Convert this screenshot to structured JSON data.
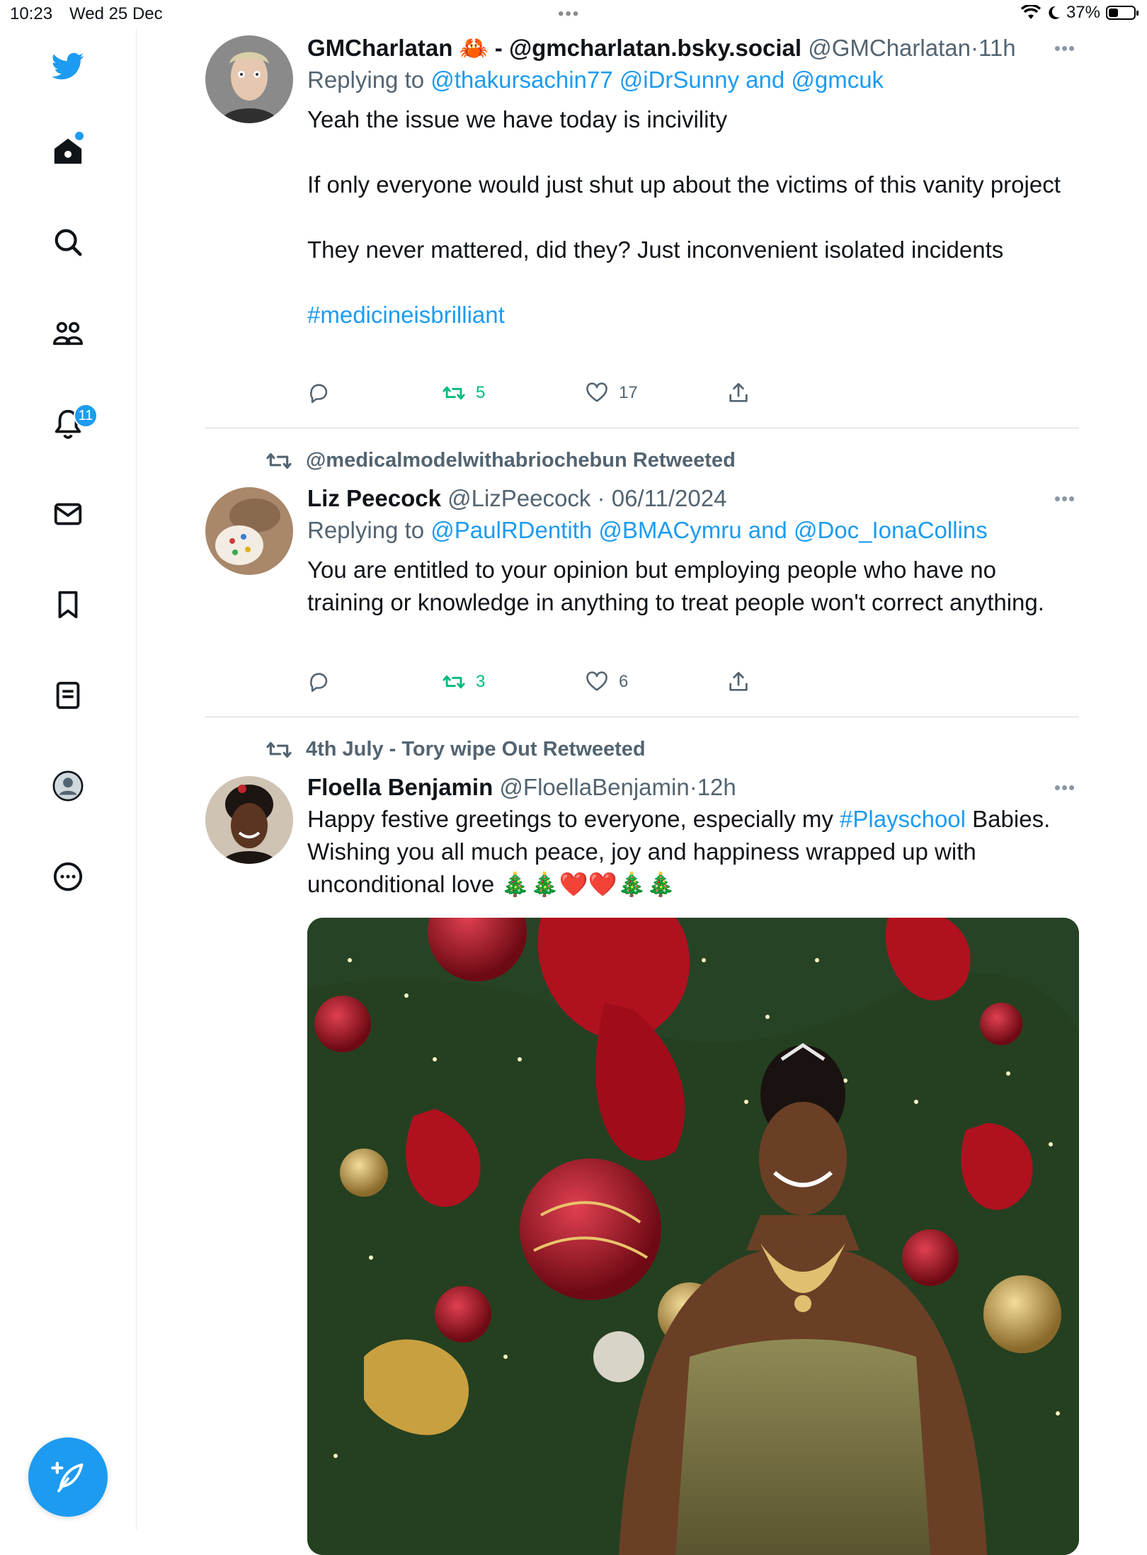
{
  "status_bar": {
    "time": "10:23",
    "date": "Wed 25 Dec",
    "battery": "37%",
    "battery_level": 0.37
  },
  "sidebar": {
    "items": [
      {
        "name": "twitter-logo",
        "icon": "bird"
      },
      {
        "name": "home",
        "icon": "home"
      },
      {
        "name": "explore",
        "icon": "search"
      },
      {
        "name": "communities",
        "icon": "people"
      },
      {
        "name": "notifications",
        "icon": "bell",
        "badge": "11"
      },
      {
        "name": "messages",
        "icon": "envelope"
      },
      {
        "name": "bookmarks",
        "icon": "bookmark"
      },
      {
        "name": "lists",
        "icon": "list"
      },
      {
        "name": "profile",
        "icon": "person"
      },
      {
        "name": "more",
        "icon": "dots-circle"
      }
    ],
    "compose_icon": "feather-plus",
    "accent": "#1d9bf0"
  },
  "tweets": [
    {
      "display_name": "GMCharlatan",
      "name_emoji": "🦀",
      "name_suffix": " - @gmcharlatan.bsky.social",
      "handle": "@GMCharlatan",
      "separator": "·",
      "time": "11h",
      "replying_prefix": "Replying to ",
      "replying_to": "@thakursachin77 @iDrSunny and @gmcuk",
      "text_paragraphs": [
        "Yeah the issue we have today is incivility",
        "If only everyone would just shut up about the victims of this vanity project",
        "They never mattered, did they? Just inconvenient isolated incidents"
      ],
      "hashtag": "#medicineisbrilliant",
      "retweets": "5",
      "likes": "17"
    },
    {
      "retweeted_by": "@medicalmodelwithabriochebun Retweeted",
      "display_name": "Liz Peecock",
      "handle": "@LizPeecock",
      "separator": "·",
      "time": "06/11/2024",
      "replying_prefix": "Replying to ",
      "replying_to": "@PaulRDentith @BMACymru and @Doc_IonaCollins",
      "text": "You are entitled to your opinion but employing people who have no training or knowledge in anything to treat people won't correct anything.",
      "retweets": "3",
      "likes": "6"
    },
    {
      "retweeted_by": "4th July - Tory wipe Out Retweeted",
      "display_name": "Floella Benjamin",
      "handle": "@FloellaBenjamin",
      "separator": "·",
      "time": "12h",
      "text_before": "Happy festive greetings to everyone, especially my ",
      "hashtag": "#Playschool",
      "text_after": " Babies. Wishing you all much peace, joy and happiness wrapped up with unconditional love 🎄🎄❤️❤️🎄🎄"
    }
  ]
}
